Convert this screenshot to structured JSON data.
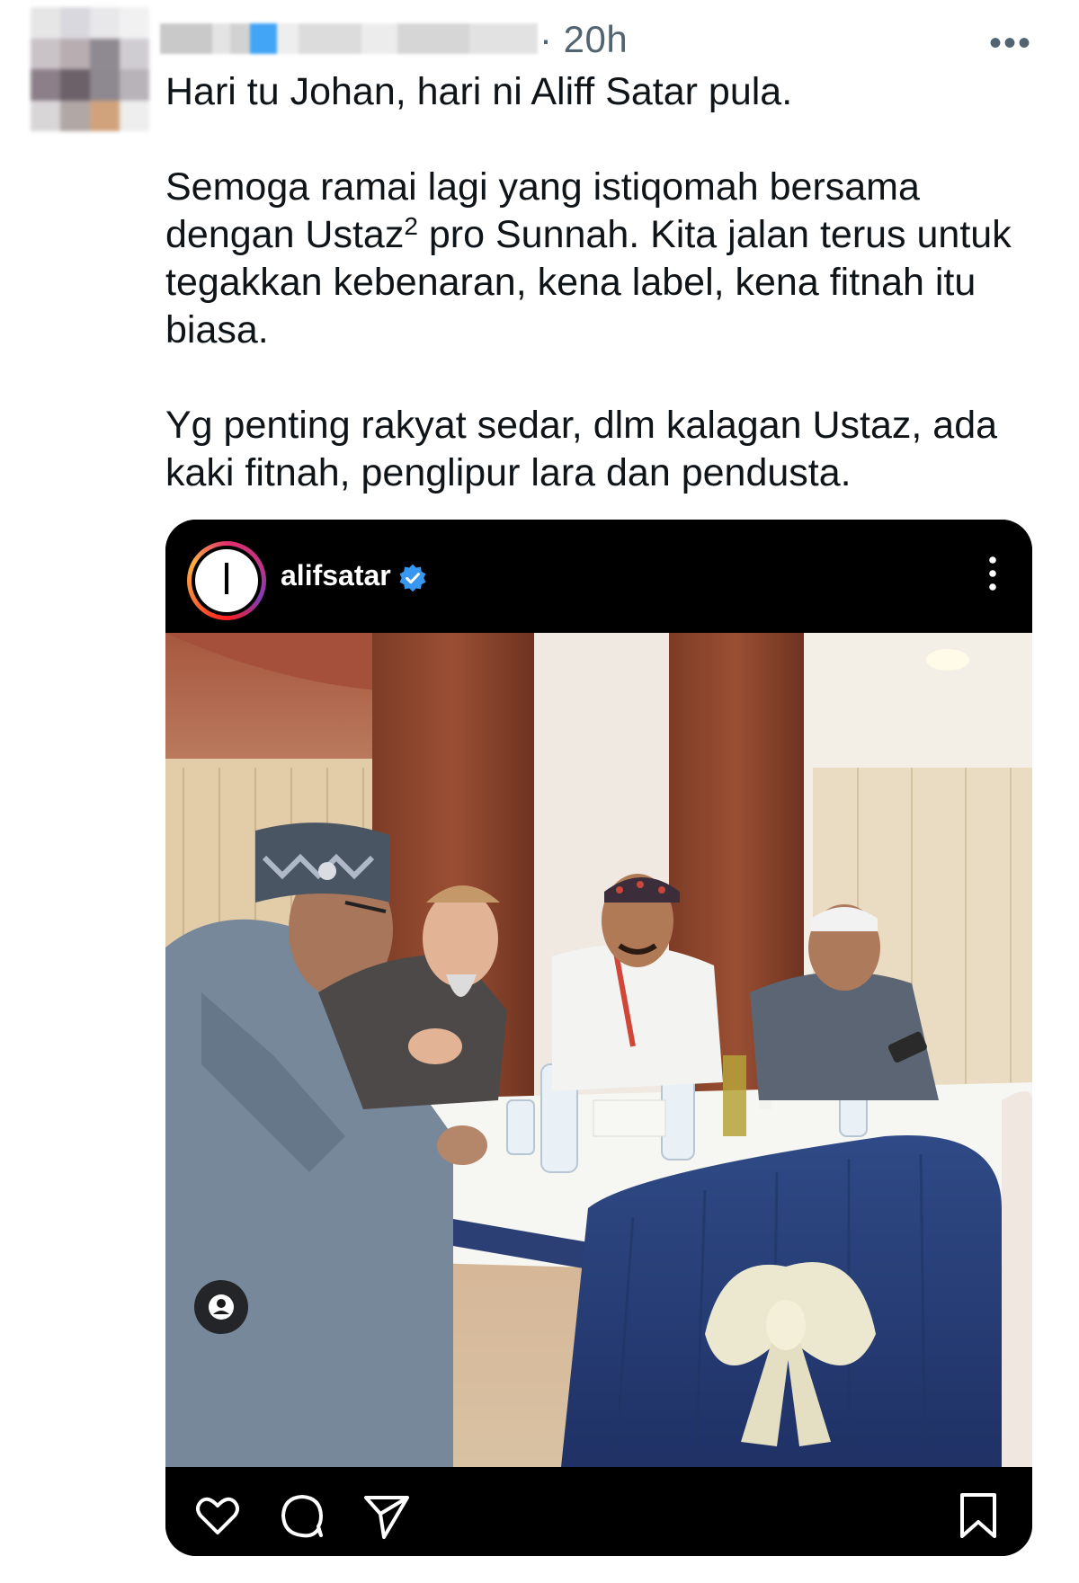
{
  "tweet": {
    "time": "· 20h",
    "more_label": "•••",
    "paragraphs": [
      "Hari tu Johan, hari ni Aliff Satar pula.",
      "Semoga ramai lagi yang istiqomah bersama dengan Ustaz",
      "2",
      " pro Sunnah. Kita jalan terus untuk tegakkan kebenaran, kena label, kena fitnah itu biasa.",
      "Yg penting rakyat sedar, dlm kalagan Ustaz, ada kaki fitnah, penglipur lara dan pendusta."
    ]
  },
  "instagram_post": {
    "username": "alifsatar",
    "avatar_glyph": "ا",
    "verified": true,
    "icons": {
      "verified": "verified-badge-icon",
      "more": "more-vertical-icon",
      "tag": "user-tag-icon",
      "like": "heart-icon",
      "comment": "comment-icon",
      "share": "send-icon",
      "save": "bookmark-icon"
    }
  },
  "colors": {
    "instagram_bg": "#000000",
    "verified_blue": "#3897f0",
    "timestamp_gray": "#536471"
  }
}
